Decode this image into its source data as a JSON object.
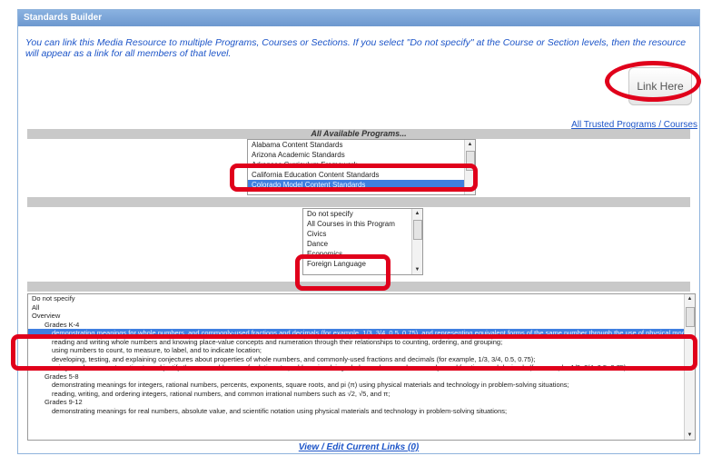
{
  "window": {
    "title": "Standards Builder"
  },
  "intro_text": "You can link this Media Resource to multiple Programs, Courses or Sections. If you select \"Do not specify\" at the Course or Section levels, then the resource will appear as a link for all members of that level.",
  "link_button": "Link Here",
  "trusted_link": "All Trusted Programs / Courses",
  "programs": {
    "header": "All Available Programs...",
    "items": [
      "Alabama Content Standards",
      "Arizona Academic Standards",
      "Arkansas Curriculum Framework",
      "California Education Content Standards",
      "Colorado Model Content Standards"
    ],
    "selected_index": 4
  },
  "courses": {
    "items": [
      "Do not specify",
      "All Courses in this Program",
      "Civics",
      "Dance",
      "Economics",
      "Foreign Language"
    ]
  },
  "standards": {
    "items": [
      {
        "text": "Do not specify",
        "level": 0
      },
      {
        "text": "All",
        "level": 0
      },
      {
        "text": "Overview",
        "level": 0
      },
      {
        "text": "Grades K-4",
        "level": 1
      },
      {
        "text": "demonstrating meanings for whole numbers, and commonly-used fractions and decimals (for example, 1/3, 3/4, 0.5, 0.75), and representing equivalent forms of the same number through the use of physical models, drawings",
        "level": 2,
        "selected": true
      },
      {
        "text": "reading and writing whole numbers and knowing place-value concepts and numeration through their relationships to counting, ordering, and grouping;",
        "level": 2
      },
      {
        "text": "using numbers to count, to measure, to label, and to indicate location;",
        "level": 2
      },
      {
        "text": "developing, testing, and explaining conjectures about properties of whole numbers, and commonly-used fractions and decimals (for example, 1/3, 3/4, 0.5, 0.75);",
        "level": 2
      },
      {
        "text": "using number sense to estimate and justify the reasonableness of solutions to problems involving whole numbers, and commonly-used fractions and decimals (for example, 1/3, 3/4, 0.5, 0.75);",
        "level": 2
      },
      {
        "text": "Grades 5-8",
        "level": 1
      },
      {
        "text": "demonstrating meanings for integers, rational numbers, percents, exponents, square roots, and pi (π) using physical materials and technology in problem-solving situations;",
        "level": 2
      },
      {
        "text": "reading, writing, and ordering integers, rational numbers, and common irrational numbers such as √2, √5, and π;",
        "level": 2
      },
      {
        "text": "Grades 9-12",
        "level": 1
      },
      {
        "text": "demonstrating meanings for real numbers, absolute value, and scientific notation using physical materials and technology in problem-solving situations;",
        "level": 2
      }
    ]
  },
  "view_edit_link": "View / Edit Current Links (0)",
  "colors": {
    "accent": "#1d55c8",
    "selection": "#3f7fe0",
    "highlight": "#e0001b",
    "titlebar": "#7aa6da"
  }
}
